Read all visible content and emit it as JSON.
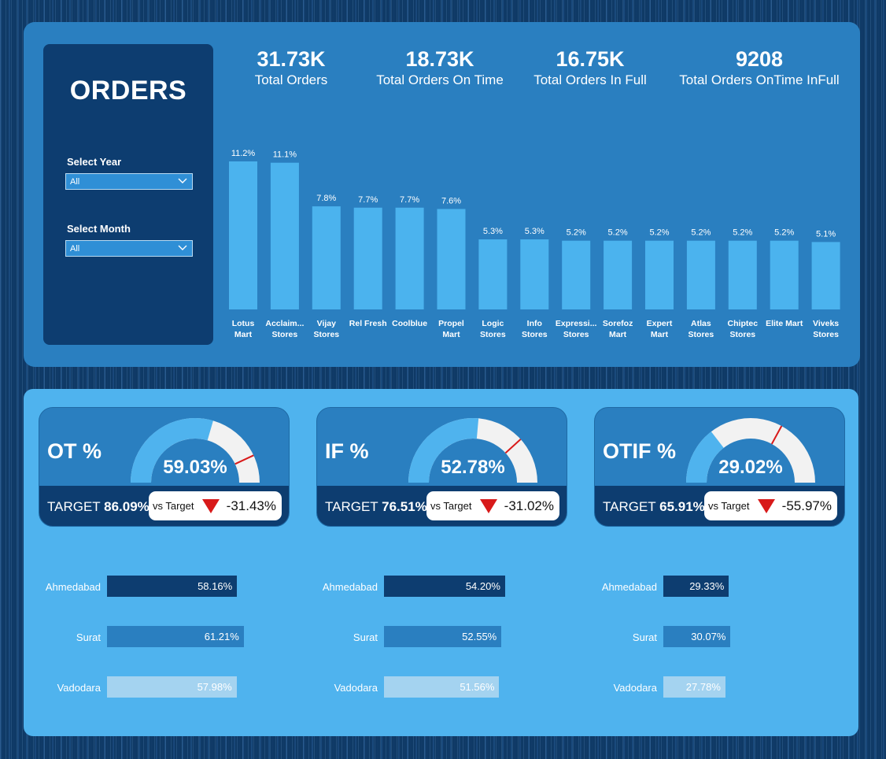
{
  "filters": {
    "title": "ORDERS",
    "year": {
      "label": "Select Year",
      "value": "All"
    },
    "month": {
      "label": "Select Month",
      "value": "All"
    }
  },
  "kpis": [
    {
      "value": "31.73K",
      "label": "Total Orders"
    },
    {
      "value": "18.73K",
      "label": "Total Orders On Time"
    },
    {
      "value": "16.75K",
      "label": "Total Orders In Full"
    },
    {
      "value": "9208",
      "label": "Total Orders OnTime InFull"
    }
  ],
  "chart_data": {
    "type": "bar",
    "categories": [
      "Lotus Mart",
      "Acclaim... Stores",
      "Vijay Stores",
      "Rel Fresh",
      "Coolblue",
      "Propel Mart",
      "Logic Stores",
      "Info Stores",
      "Expressi... Stores",
      "Sorefoz Mart",
      "Expert Mart",
      "Atlas Stores",
      "Chiptec Stores",
      "Elite Mart",
      "Viveks Stores"
    ],
    "category_lines": [
      [
        "Lotus",
        "Mart"
      ],
      [
        "Acclaim...",
        "Stores"
      ],
      [
        "Vijay",
        "Stores"
      ],
      [
        "Rel Fresh"
      ],
      [
        "Coolblue"
      ],
      [
        "Propel",
        "Mart"
      ],
      [
        "Logic",
        "Stores"
      ],
      [
        "Info",
        "Stores"
      ],
      [
        "Expressi...",
        "Stores"
      ],
      [
        "Sorefoz",
        "Mart"
      ],
      [
        "Expert",
        "Mart"
      ],
      [
        "Atlas",
        "Stores"
      ],
      [
        "Chiptec",
        "Stores"
      ],
      [
        "Elite Mart"
      ],
      [
        "Viveks",
        "Stores"
      ]
    ],
    "values": [
      11.2,
      11.1,
      7.8,
      7.7,
      7.7,
      7.6,
      5.3,
      5.3,
      5.2,
      5.2,
      5.2,
      5.2,
      5.2,
      5.2,
      5.1
    ],
    "labels": [
      "11.2%",
      "11.1%",
      "7.8%",
      "7.7%",
      "7.7%",
      "7.6%",
      "5.3%",
      "5.3%",
      "5.2%",
      "5.2%",
      "5.2%",
      "5.2%",
      "5.2%",
      "5.2%",
      "5.1%"
    ],
    "bar_color": "#4bb3ee"
  },
  "gauges": [
    {
      "title": "OT %",
      "value": "59.03%",
      "fraction": 0.5903,
      "target_fraction": 0.8609,
      "target_label": "TARGET",
      "target_value": "86.09%",
      "vs_label": "vs Target",
      "delta": "-31.43%"
    },
    {
      "title": "IF %",
      "value": "52.78%",
      "fraction": 0.5278,
      "target_fraction": 0.7651,
      "target_label": "TARGET",
      "target_value": "76.51%",
      "vs_label": "vs Target",
      "delta": "-31.02%"
    },
    {
      "title": "OTIF %",
      "value": "29.02%",
      "fraction": 0.2902,
      "target_fraction": 0.6591,
      "target_label": "TARGET",
      "target_value": "65.91%",
      "vs_label": "vs Target",
      "delta": "-55.97%"
    }
  ],
  "city_breakdown": [
    {
      "rows": [
        {
          "city": "Ahmedabad",
          "value": 58.16,
          "label": "58.16%"
        },
        {
          "city": "Surat",
          "value": 61.21,
          "label": "61.21%"
        },
        {
          "city": "Vadodara",
          "value": 57.98,
          "label": "57.98%"
        }
      ]
    },
    {
      "rows": [
        {
          "city": "Ahmedabad",
          "value": 54.2,
          "label": "54.20%"
        },
        {
          "city": "Surat",
          "value": 52.55,
          "label": "52.55%"
        },
        {
          "city": "Vadodara",
          "value": 51.56,
          "label": "51.56%"
        }
      ]
    },
    {
      "rows": [
        {
          "city": "Ahmedabad",
          "value": 29.33,
          "label": "29.33%"
        },
        {
          "city": "Surat",
          "value": 30.07,
          "label": "30.07%"
        },
        {
          "city": "Vadodara",
          "value": 27.78,
          "label": "27.78%"
        }
      ]
    }
  ],
  "colors": {
    "gauge_fill": "#4fb3ee",
    "gauge_track": "#f2f2f2",
    "target_marker": "#d81a1a",
    "city_colors": [
      "#0d3d70",
      "#2a7fc0",
      "#a4d3f0"
    ]
  }
}
